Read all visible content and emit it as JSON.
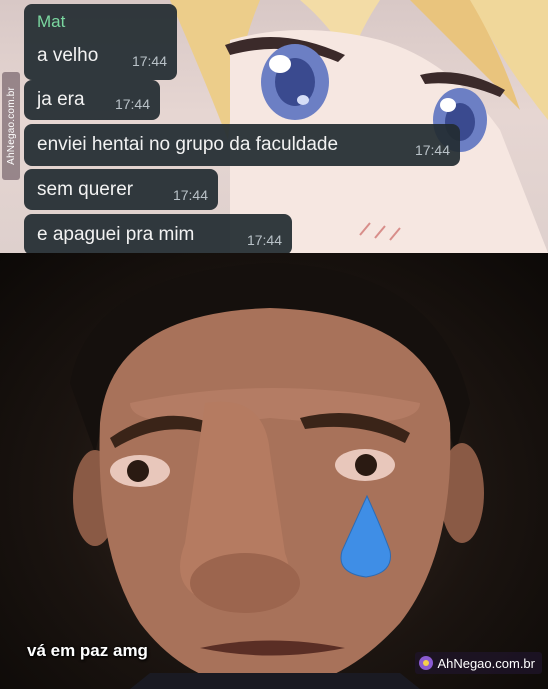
{
  "chat": {
    "sender": "Mat",
    "messages": [
      {
        "text": "a velho",
        "time": "17:44"
      },
      {
        "text": "ja era",
        "time": "17:44"
      },
      {
        "text": "enviei hentai no grupo da faculdade",
        "time": "17:44"
      },
      {
        "text": "sem querer",
        "time": "17:44"
      },
      {
        "text": "e apaguei pra mim",
        "time": "17:44"
      }
    ]
  },
  "watermark": {
    "side_text": "AhNegao.com.br",
    "badge_text": "AhNegao.com.br"
  },
  "meme": {
    "caption": "vá em paz amg"
  },
  "colors": {
    "bubble": "#222c32",
    "sender_name": "#7ad7a0",
    "tear": "#3f8ee6"
  }
}
